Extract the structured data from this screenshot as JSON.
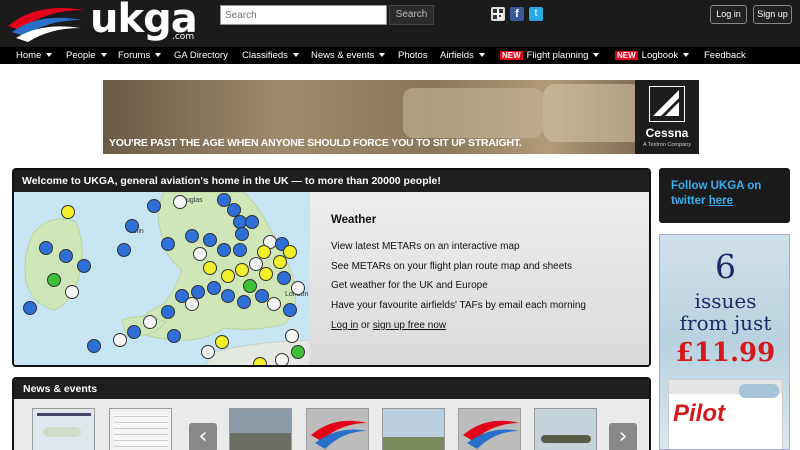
{
  "header": {
    "logo_text": "ukga",
    "logo_sub": ".com",
    "search_placeholder": "Search",
    "search_button": "Search",
    "social": {
      "qr": "qr-code-icon",
      "facebook": "f",
      "twitter": "t"
    },
    "login_label": "Log in",
    "signup_label": "Sign up"
  },
  "nav": {
    "new_badge": "NEW",
    "items": [
      "Home",
      "People",
      "Forums",
      "GA Directory",
      "Classifieds",
      "News & events",
      "Photos",
      "Airfields",
      "Flight planning",
      "Logbook",
      "Feedback"
    ]
  },
  "ad": {
    "tagline": "YOU'RE PAST THE AGE WHEN ANYONE SHOULD FORCE YOU TO SIT UP STRAIGHT.",
    "brand": "Cessna",
    "brand_sub": "A Textron Company"
  },
  "welcome": {
    "title": "Welcome to UKGA, general aviation's home in the UK — to more than 20000 people!",
    "map_labels": {
      "douglas": "Douglas",
      "dublin": "ublin",
      "london": "London"
    },
    "weather_title": "Weather",
    "lines": [
      "View latest METARs on an interactive map",
      "See METARs on your flight plan route map and sheets",
      "Get weather for the UK and Europe",
      "Have your favourite airfields' TAFs by email each morning"
    ],
    "login_link": "Log in",
    "or_text": "or",
    "signup_link": "sign up free now"
  },
  "sidebar": {
    "follow_text": "Follow UKGA on twitter",
    "follow_link": "here",
    "pilot_ad": {
      "num": "6",
      "line1": "issues",
      "line2": "from just",
      "price": "£11.99",
      "mag_title": "Pilot"
    }
  },
  "news": {
    "title": "News & events",
    "prev": "‹",
    "next": "›"
  },
  "colors": {
    "accent_red": "#e2001a",
    "twitter_blue": "#3ab0f0",
    "header_bg": "#1b1b1b"
  }
}
